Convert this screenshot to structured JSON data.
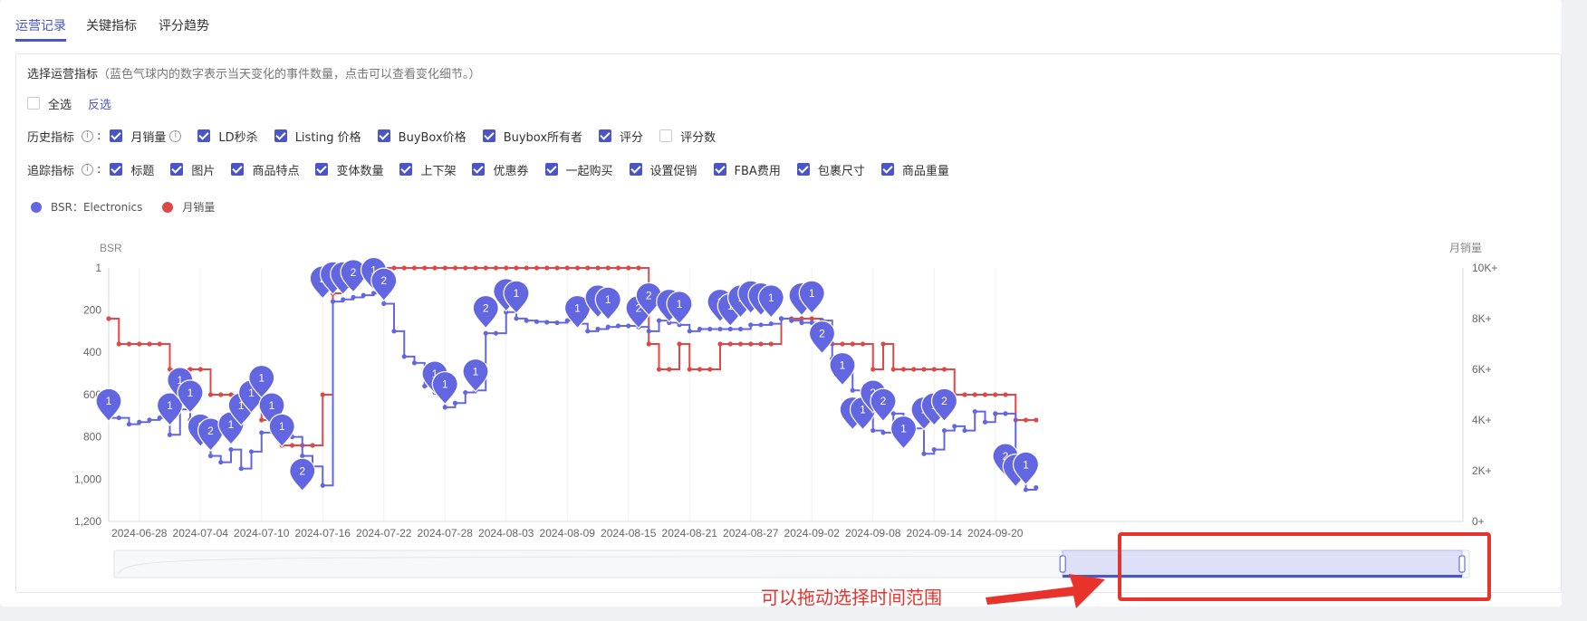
{
  "tabs": [
    {
      "label": "运营记录",
      "active": true
    },
    {
      "label": "关键指标",
      "active": false
    },
    {
      "label": "评分趋势",
      "active": false
    }
  ],
  "intro": {
    "title": "选择运营指标",
    "hint": "（蓝色气球内的数字表示当天变化的事件数量，点击可以查看变化细节。）"
  },
  "select": {
    "all_label": "全选",
    "invert_label": "反选"
  },
  "history": {
    "title": "历史指标",
    "items": [
      {
        "label": "月销量",
        "checked": true,
        "info": true
      },
      {
        "label": "LD秒杀",
        "checked": true
      },
      {
        "label": "Listing 价格",
        "checked": true
      },
      {
        "label": "BuyBox价格",
        "checked": true
      },
      {
        "label": "Buybox所有者",
        "checked": true
      },
      {
        "label": "评分",
        "checked": true
      },
      {
        "label": "评分数",
        "checked": false
      }
    ]
  },
  "tracking": {
    "title": "追踪指标",
    "items": [
      {
        "label": "标题",
        "checked": true
      },
      {
        "label": "图片",
        "checked": true
      },
      {
        "label": "商品特点",
        "checked": true
      },
      {
        "label": "变体数量",
        "checked": true
      },
      {
        "label": "上下架",
        "checked": true
      },
      {
        "label": "优惠券",
        "checked": true
      },
      {
        "label": "一起购买",
        "checked": true
      },
      {
        "label": "设置促销",
        "checked": true
      },
      {
        "label": "FBA费用",
        "checked": true
      },
      {
        "label": "包裹尺寸",
        "checked": true
      },
      {
        "label": "商品重量",
        "checked": true
      }
    ]
  },
  "colors": {
    "accent": "#4a55c8",
    "bsr": "#6366e1",
    "sales": "#e04848",
    "annotation": "#e8322c"
  },
  "annotation": {
    "text": "可以拖动选择时间范围"
  },
  "chart_data": {
    "type": "line",
    "legend": [
      {
        "name": "BSR：Electronics",
        "color": "#6366e1"
      },
      {
        "name": "月销量",
        "color": "#e04848"
      }
    ],
    "legend_position": "top-left",
    "y_left_label": "BSR",
    "y_right_label": "月销量",
    "y_left_ticks": [
      "1",
      "200",
      "400",
      "600",
      "800",
      "1,000",
      "1,200"
    ],
    "y_left_range": [
      1,
      1200
    ],
    "y_left_inverted": true,
    "y_right_ticks": [
      "0+",
      "2K+",
      "4K+",
      "6K+",
      "8K+",
      "10K+"
    ],
    "y_right_range": [
      0,
      10000
    ],
    "x_range": [
      "2024-06-25",
      "2024-09-11"
    ],
    "x_ticks": [
      "2024-06-28",
      "2024-07-04",
      "2024-07-10",
      "2024-07-16",
      "2024-07-22",
      "2024-07-28",
      "2024-08-03",
      "2024-08-09",
      "2024-08-15",
      "2024-08-21",
      "2024-08-27",
      "2024-09-02",
      "2024-09-08",
      "2024-09-14",
      "2024-09-20"
    ],
    "grid_vertical": true,
    "bsr": [
      [
        "2024-06-25",
        710
      ],
      [
        "2024-06-26",
        710
      ],
      [
        "2024-06-27",
        740
      ],
      [
        "2024-06-28",
        730
      ],
      [
        "2024-06-29",
        720
      ],
      [
        "2024-06-30",
        710
      ],
      [
        "2024-07-01",
        790
      ],
      [
        "2024-07-02",
        670
      ],
      [
        "2024-07-03",
        720
      ],
      [
        "2024-07-04",
        750
      ],
      [
        "2024-07-05",
        890
      ],
      [
        "2024-07-06",
        920
      ],
      [
        "2024-07-07",
        860
      ],
      [
        "2024-07-08",
        950
      ],
      [
        "2024-07-09",
        870
      ],
      [
        "2024-07-10",
        780
      ],
      [
        "2024-07-11",
        700
      ],
      [
        "2024-07-12",
        720
      ],
      [
        "2024-07-13",
        800
      ],
      [
        "2024-07-14",
        890
      ],
      [
        "2024-07-15",
        940
      ],
      [
        "2024-07-16",
        1030
      ],
      [
        "2024-07-17",
        160
      ],
      [
        "2024-07-18",
        150
      ],
      [
        "2024-07-19",
        140
      ],
      [
        "2024-07-20",
        130
      ],
      [
        "2024-07-21",
        120
      ],
      [
        "2024-07-22",
        170
      ],
      [
        "2024-07-23",
        300
      ],
      [
        "2024-07-24",
        420
      ],
      [
        "2024-07-25",
        450
      ],
      [
        "2024-07-26",
        560
      ],
      [
        "2024-07-27",
        590
      ],
      [
        "2024-07-28",
        660
      ],
      [
        "2024-07-29",
        640
      ],
      [
        "2024-07-30",
        590
      ],
      [
        "2024-07-31",
        580
      ],
      [
        "2024-08-01",
        310
      ],
      [
        "2024-08-02",
        310
      ],
      [
        "2024-08-03",
        210
      ],
      [
        "2024-08-04",
        240
      ],
      [
        "2024-08-05",
        250
      ],
      [
        "2024-08-06",
        255
      ],
      [
        "2024-08-07",
        258
      ],
      [
        "2024-08-08",
        260
      ],
      [
        "2024-08-09",
        250
      ],
      [
        "2024-08-10",
        265
      ],
      [
        "2024-08-11",
        300
      ],
      [
        "2024-08-12",
        290
      ],
      [
        "2024-08-13",
        280
      ],
      [
        "2024-08-14",
        275
      ],
      [
        "2024-08-15",
        275
      ],
      [
        "2024-08-16",
        280
      ],
      [
        "2024-08-17",
        300
      ],
      [
        "2024-08-18",
        250
      ],
      [
        "2024-08-19",
        260
      ],
      [
        "2024-08-20",
        270
      ],
      [
        "2024-08-21",
        300
      ],
      [
        "2024-08-22",
        290
      ],
      [
        "2024-08-23",
        290
      ],
      [
        "2024-08-24",
        290
      ],
      [
        "2024-08-25",
        290
      ],
      [
        "2024-08-26",
        290
      ],
      [
        "2024-08-27",
        270
      ],
      [
        "2024-08-28",
        270
      ],
      [
        "2024-08-29",
        265
      ],
      [
        "2024-08-30",
        240
      ],
      [
        "2024-08-31",
        250
      ],
      [
        "2024-09-01",
        260
      ],
      [
        "2024-09-02",
        260
      ],
      [
        "2024-09-03",
        250
      ],
      [
        "2024-09-04",
        430
      ],
      [
        "2024-09-05",
        480
      ],
      [
        "2024-09-06",
        580
      ],
      [
        "2024-09-07",
        630
      ],
      [
        "2024-09-08",
        770
      ],
      [
        "2024-09-09",
        780
      ],
      [
        "2024-09-10",
        690
      ],
      [
        "2024-09-11",
        740
      ],
      [
        "2024-09-12",
        760
      ],
      [
        "2024-09-13",
        880
      ],
      [
        "2024-09-14",
        860
      ],
      [
        "2024-09-15",
        770
      ],
      [
        "2024-09-16",
        750
      ],
      [
        "2024-09-17",
        770
      ],
      [
        "2024-09-18",
        680
      ],
      [
        "2024-09-19",
        730
      ],
      [
        "2024-09-20",
        690
      ],
      [
        "2024-09-21",
        690
      ],
      [
        "2024-09-22",
        980
      ],
      [
        "2024-09-23",
        1050
      ],
      [
        "2024-09-24",
        1040
      ]
    ],
    "sales": [
      [
        "2024-06-25",
        8000
      ],
      [
        "2024-06-26",
        7000
      ],
      [
        "2024-06-27",
        7000
      ],
      [
        "2024-06-28",
        7000
      ],
      [
        "2024-06-29",
        7000
      ],
      [
        "2024-06-30",
        7000
      ],
      [
        "2024-07-01",
        6000
      ],
      [
        "2024-07-02",
        6000
      ],
      [
        "2024-07-03",
        6000
      ],
      [
        "2024-07-04",
        6000
      ],
      [
        "2024-07-05",
        5000
      ],
      [
        "2024-07-06",
        5000
      ],
      [
        "2024-07-07",
        5000
      ],
      [
        "2024-07-08",
        5000
      ],
      [
        "2024-07-09",
        5000
      ],
      [
        "2024-07-10",
        4000
      ],
      [
        "2024-07-11",
        4000
      ],
      [
        "2024-07-12",
        3000
      ],
      [
        "2024-07-13",
        3000
      ],
      [
        "2024-07-14",
        3000
      ],
      [
        "2024-07-15",
        3000
      ],
      [
        "2024-07-16",
        5000
      ],
      [
        "2024-07-17",
        9000
      ],
      [
        "2024-07-18",
        10000
      ],
      [
        "2024-07-19",
        10000
      ],
      [
        "2024-07-20",
        10000
      ],
      [
        "2024-07-21",
        10000
      ],
      [
        "2024-07-22",
        10000
      ],
      [
        "2024-07-23",
        10000
      ],
      [
        "2024-07-24",
        10000
      ],
      [
        "2024-07-25",
        10000
      ],
      [
        "2024-07-26",
        10000
      ],
      [
        "2024-07-27",
        10000
      ],
      [
        "2024-07-28",
        10000
      ],
      [
        "2024-07-29",
        10000
      ],
      [
        "2024-07-30",
        10000
      ],
      [
        "2024-07-31",
        10000
      ],
      [
        "2024-08-01",
        10000
      ],
      [
        "2024-08-02",
        10000
      ],
      [
        "2024-08-03",
        10000
      ],
      [
        "2024-08-04",
        10000
      ],
      [
        "2024-08-05",
        10000
      ],
      [
        "2024-08-06",
        10000
      ],
      [
        "2024-08-07",
        10000
      ],
      [
        "2024-08-08",
        10000
      ],
      [
        "2024-08-09",
        10000
      ],
      [
        "2024-08-10",
        10000
      ],
      [
        "2024-08-11",
        10000
      ],
      [
        "2024-08-12",
        10000
      ],
      [
        "2024-08-13",
        10000
      ],
      [
        "2024-08-14",
        10000
      ],
      [
        "2024-08-15",
        10000
      ],
      [
        "2024-08-16",
        10000
      ],
      [
        "2024-08-17",
        7000
      ],
      [
        "2024-08-18",
        6000
      ],
      [
        "2024-08-19",
        6000
      ],
      [
        "2024-08-20",
        7000
      ],
      [
        "2024-08-21",
        6000
      ],
      [
        "2024-08-22",
        6000
      ],
      [
        "2024-08-23",
        6000
      ],
      [
        "2024-08-24",
        7000
      ],
      [
        "2024-08-25",
        7000
      ],
      [
        "2024-08-26",
        7000
      ],
      [
        "2024-08-27",
        7000
      ],
      [
        "2024-08-28",
        7000
      ],
      [
        "2024-08-29",
        7000
      ],
      [
        "2024-08-30",
        8000
      ],
      [
        "2024-08-31",
        8000
      ],
      [
        "2024-09-01",
        8000
      ],
      [
        "2024-09-02",
        8000
      ],
      [
        "2024-09-03",
        7000
      ],
      [
        "2024-09-04",
        7000
      ],
      [
        "2024-09-05",
        7000
      ],
      [
        "2024-09-06",
        7000
      ],
      [
        "2024-09-07",
        7000
      ],
      [
        "2024-09-08",
        6000
      ],
      [
        "2024-09-09",
        7000
      ],
      [
        "2024-09-10",
        6000
      ],
      [
        "2024-09-11",
        6000
      ],
      [
        "2024-09-12",
        6000
      ],
      [
        "2024-09-13",
        6000
      ],
      [
        "2024-09-14",
        6000
      ],
      [
        "2024-09-15",
        6000
      ],
      [
        "2024-09-16",
        5000
      ],
      [
        "2024-09-17",
        5000
      ],
      [
        "2024-09-18",
        5000
      ],
      [
        "2024-09-19",
        5000
      ],
      [
        "2024-09-20",
        5000
      ],
      [
        "2024-09-21",
        5000
      ],
      [
        "2024-09-22",
        4000
      ],
      [
        "2024-09-23",
        4000
      ],
      [
        "2024-09-24",
        4000
      ]
    ],
    "events": [
      [
        "2024-06-25",
        640,
        "1"
      ],
      [
        "2024-07-01",
        660,
        "1"
      ],
      [
        "2024-07-02",
        540,
        "1"
      ],
      [
        "2024-07-03",
        600,
        "1"
      ],
      [
        "2024-07-04",
        760,
        "1"
      ],
      [
        "2024-07-05",
        780,
        "2"
      ],
      [
        "2024-07-07",
        750,
        "1"
      ],
      [
        "2024-07-08",
        660,
        "1"
      ],
      [
        "2024-07-09",
        600,
        "1"
      ],
      [
        "2024-07-10",
        530,
        "1"
      ],
      [
        "2024-07-11",
        660,
        "1"
      ],
      [
        "2024-07-12",
        760,
        "1"
      ],
      [
        "2024-07-14",
        970,
        "2"
      ],
      [
        "2024-07-16",
        60,
        "2"
      ],
      [
        "2024-07-17",
        40,
        "2"
      ],
      [
        "2024-07-18",
        40,
        "3"
      ],
      [
        "2024-07-19",
        30,
        "2"
      ],
      [
        "2024-07-21",
        20,
        "1"
      ],
      [
        "2024-07-22",
        70,
        "2"
      ],
      [
        "2024-07-27",
        510,
        "1"
      ],
      [
        "2024-07-28",
        560,
        "1"
      ],
      [
        "2024-07-31",
        500,
        "1"
      ],
      [
        "2024-08-01",
        200,
        "2"
      ],
      [
        "2024-08-03",
        120,
        "1"
      ],
      [
        "2024-08-04",
        130,
        "1"
      ],
      [
        "2024-08-10",
        200,
        "1"
      ],
      [
        "2024-08-12",
        150,
        "1"
      ],
      [
        "2024-08-13",
        160,
        "1"
      ],
      [
        "2024-08-16",
        200,
        "2"
      ],
      [
        "2024-08-17",
        140,
        "2"
      ],
      [
        "2024-08-19",
        170,
        "1"
      ],
      [
        "2024-08-20",
        180,
        "1"
      ],
      [
        "2024-08-24",
        170,
        "1"
      ],
      [
        "2024-08-25",
        190,
        "1"
      ],
      [
        "2024-08-26",
        150,
        "1"
      ],
      [
        "2024-08-27",
        130,
        "1"
      ],
      [
        "2024-08-28",
        140,
        "1"
      ],
      [
        "2024-08-29",
        150,
        "1"
      ],
      [
        "2024-09-01",
        140,
        "1"
      ],
      [
        "2024-09-02",
        130,
        "1"
      ],
      [
        "2024-09-03",
        320,
        "2"
      ],
      [
        "2024-09-05",
        470,
        "1"
      ],
      [
        "2024-09-06",
        680,
        "1"
      ],
      [
        "2024-09-07",
        680,
        "1"
      ],
      [
        "2024-09-08",
        600,
        "2"
      ],
      [
        "2024-09-09",
        640,
        "2"
      ],
      [
        "2024-09-11",
        770,
        "1"
      ],
      [
        "2024-09-13",
        680,
        "1"
      ],
      [
        "2024-09-14",
        660,
        "1"
      ],
      [
        "2024-09-15",
        640,
        "2"
      ],
      [
        "2024-09-21",
        900,
        "2"
      ],
      [
        "2024-09-22",
        950,
        "1"
      ],
      [
        "2024-09-23",
        940,
        "1"
      ]
    ],
    "range_selector": {
      "start_fraction": 0.7,
      "end_fraction": 1.0
    }
  }
}
